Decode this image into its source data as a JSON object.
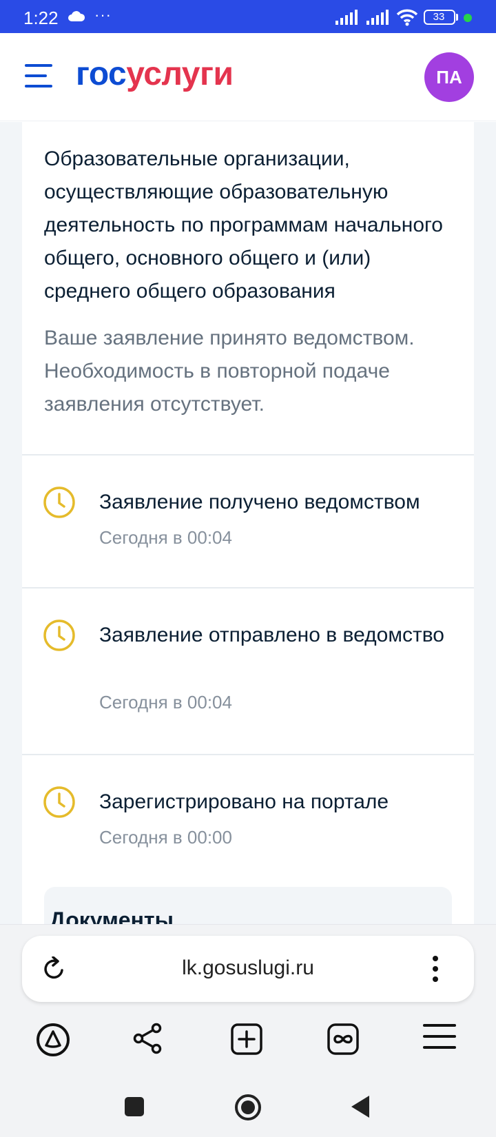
{
  "status_bar": {
    "time": "1:22",
    "dots": "···",
    "battery": "33",
    "colors": {
      "background": "#2a4be6",
      "indicator": "#27d34a"
    }
  },
  "header": {
    "logo_part1": "гос",
    "logo_part2": "услуги",
    "avatar_initials": "ПА",
    "colors": {
      "logo_blue": "#0d4cd3",
      "logo_red": "#e4344e",
      "avatar": "#a23fe0"
    }
  },
  "application": {
    "organization": "Образовательные организации, осуществляющие образовательную деятельность по программам начального общего, основного общего и (или) среднего общего образования",
    "status_message": "Ваше заявление принято ведомством. Необходимость в повторной подаче заявления отсутствует."
  },
  "history": [
    {
      "title": "Заявление получено ведомством",
      "time": "Сегодня в 00:04"
    },
    {
      "title": "Заявление отправлено в ведомство",
      "time": "Сегодня в 00:04"
    },
    {
      "title": "Зарегистрировано на портале",
      "time": "Сегодня в 00:00"
    }
  ],
  "documents": {
    "title": "Документы"
  },
  "browser": {
    "url": "lk.gosuslugi.ru",
    "toolbar_icons": [
      "alice-icon",
      "share-icon",
      "new-tab-icon",
      "tabs-icon",
      "menu-icon"
    ]
  },
  "system_nav": [
    "recents-icon",
    "home-icon",
    "back-icon"
  ],
  "icon_colors": {
    "clock": "#e5bb2b"
  }
}
